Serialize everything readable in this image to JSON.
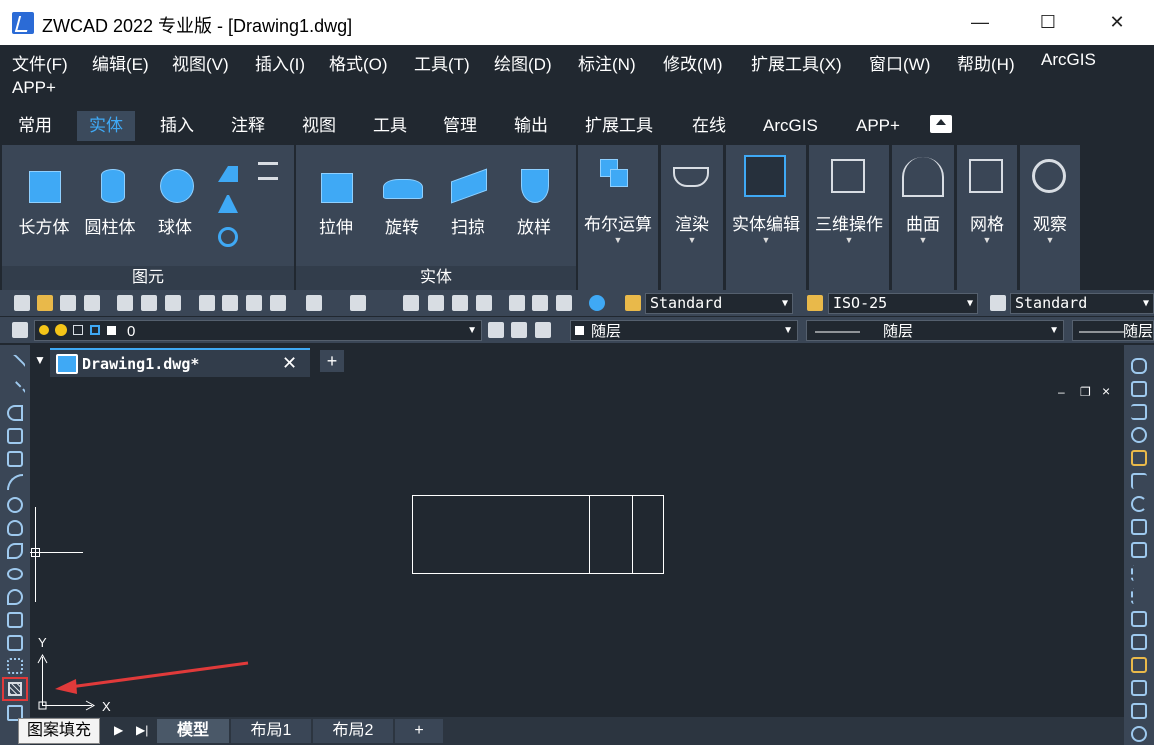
{
  "window": {
    "title": "ZWCAD 2022 专业版 - [Drawing1.dwg]",
    "minimize": "—",
    "maximize": "☐",
    "close": "✕"
  },
  "menu": [
    "文件(F)",
    "编辑(E)",
    "视图(V)",
    "插入(I)",
    "格式(O)",
    "工具(T)",
    "绘图(D)",
    "标注(N)",
    "修改(M)",
    "扩展工具(X)",
    "窗口(W)",
    "帮助(H)",
    "ArcGIS",
    "APP+"
  ],
  "ribbon_tabs": [
    "常用",
    "实体",
    "插入",
    "注释",
    "视图",
    "工具",
    "管理",
    "输出",
    "扩展工具",
    "在线",
    "ArcGIS",
    "APP+"
  ],
  "active_tab": "实体",
  "panels": {
    "primitives": {
      "title": "图元",
      "buttons": [
        "长方体",
        "圆柱体",
        "球体"
      ]
    },
    "solid": {
      "title": "实体",
      "buttons": [
        "拉伸",
        "旋转",
        "扫掠",
        "放样"
      ]
    },
    "dropdowns": [
      "布尔运算",
      "渲染",
      "实体编辑",
      "三维操作",
      "曲面",
      "网格",
      "观察"
    ]
  },
  "toolbar1": {
    "text_style": "Standard",
    "dim_style": "ISO-25",
    "table_style": "Standard"
  },
  "toolbar2": {
    "layer": "0",
    "color": "随层",
    "linetype": "随层",
    "lineweight": "随层",
    "line_sample": "———"
  },
  "document_tab": {
    "label": "Drawing1.dwg*",
    "new_tab": "+"
  },
  "viewport_controls": {
    "minimize": "–",
    "restore": "❐",
    "close": "×"
  },
  "ucs": {
    "x_label": "X",
    "y_label": "Y"
  },
  "layout_tabs": [
    "模型",
    "布局1",
    "布局2",
    "+"
  ],
  "tooltip": "图案填充",
  "colors": {
    "accent": "#3fa9f5",
    "highlight": "#e03a3a",
    "panel": "#3a4656",
    "background": "#212830"
  }
}
